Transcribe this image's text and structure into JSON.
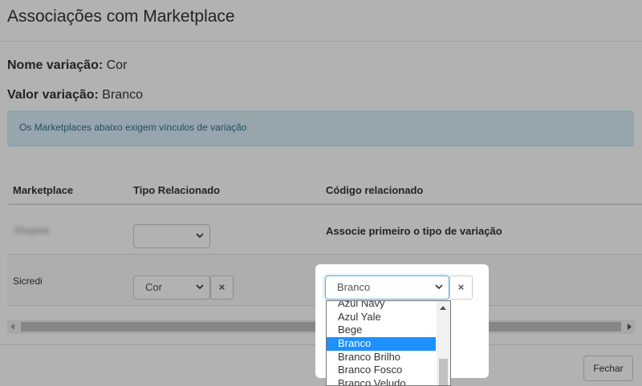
{
  "modal": {
    "title": "Associações com Marketplace",
    "variation_name_label": "Nome variação:",
    "variation_name_value": "Cor",
    "variation_value_label": "Valor variação:",
    "variation_value_value": "Branco",
    "alert": "Os Marketplaces abaixo exigem vínculos de variação",
    "close_label": "Fechar"
  },
  "table": {
    "headers": [
      "Marketplace",
      "Tipo Relacionado",
      "Código relacionado"
    ],
    "rows": [
      {
        "marketplace": "Shopee",
        "tipo": "",
        "codigo_text": "Associe primeiro o tipo de variação"
      },
      {
        "marketplace": "Sicredi",
        "tipo": "Cor",
        "codigo": "Branco"
      }
    ]
  },
  "dropdown": {
    "options": [
      "Azul Navy",
      "Azul Yale",
      "Bege",
      "Branco",
      "Branco Brilho",
      "Branco Fosco",
      "Branco Veludo"
    ],
    "selected": "Branco"
  },
  "icons": {
    "remove": "×"
  }
}
